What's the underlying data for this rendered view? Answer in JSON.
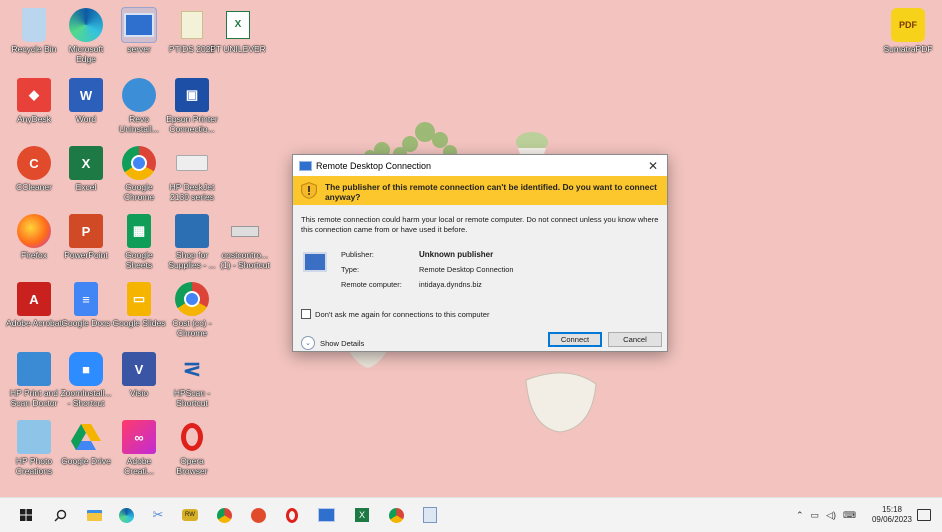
{
  "desktop": {
    "icons": [
      {
        "label": "Recycle Bin"
      },
      {
        "label": "Microsoft Edge"
      },
      {
        "label": "server"
      },
      {
        "label": "PTIDS 2022"
      },
      {
        "label": "PT UNILEVER"
      },
      {
        "label": "AnyDesk"
      },
      {
        "label": "Word"
      },
      {
        "label": "Revo Uninstall..."
      },
      {
        "label": "Epson Printer Connectio..."
      },
      {
        "label": "CCleaner"
      },
      {
        "label": "Excel"
      },
      {
        "label": "Google Chrome"
      },
      {
        "label": "HP DeskJet 2130 series"
      },
      {
        "label": "Firefox"
      },
      {
        "label": "PowerPoint"
      },
      {
        "label": "Google Sheets"
      },
      {
        "label": "Shop for Supplies - ..."
      },
      {
        "label": "costcontro... (1) - Shortcut"
      },
      {
        "label": "Adobe Acrobat"
      },
      {
        "label": "Google Docs"
      },
      {
        "label": "Google Slides"
      },
      {
        "label": "Cost (cc) - Chrome"
      },
      {
        "label": "HP Print and Scan Doctor"
      },
      {
        "label": "ZoomInstall... - Shortcut"
      },
      {
        "label": "Visio"
      },
      {
        "label": "HPScan - Shortcut"
      },
      {
        "label": "HP Photo Creations"
      },
      {
        "label": "Google Drive"
      },
      {
        "label": "Adobe Creati..."
      },
      {
        "label": "Opera Browser"
      },
      {
        "label": "SumatraPDF"
      }
    ],
    "sumatra_badge": "PDF"
  },
  "dialog": {
    "title": "Remote Desktop Connection",
    "close_glyph": "✕",
    "warning": "The publisher of this remote connection can't be identified. Do you want to connect anyway?",
    "body": "This remote connection could harm your local or remote computer. Do not connect unless you know where this connection came from or have used it before.",
    "publisher_label": "Publisher:",
    "publisher_value": "Unknown publisher",
    "type_label": "Type:",
    "type_value": "Remote Desktop Connection",
    "remote_label": "Remote computer:",
    "remote_value": "intidaya.dyndns.biz",
    "dont_ask": "Don't ask me again for connections to this computer",
    "show_details": "Show Details",
    "connect": "Connect",
    "cancel": "Cancel"
  },
  "taskbar": {
    "time": "15:18",
    "date": "09/06/2023",
    "apps": [
      "windows-start",
      "search",
      "file-explorer",
      "edge",
      "snipping-tool",
      "rdp-app",
      "chrome",
      "ccleaner",
      "opera",
      "remote-desktop",
      "excel",
      "chrome-profile",
      "notepad"
    ],
    "tray_icons": [
      "chevron-up-icon",
      "network-icon",
      "volume-icon",
      "keyboard-icon",
      "notification-icon"
    ]
  }
}
